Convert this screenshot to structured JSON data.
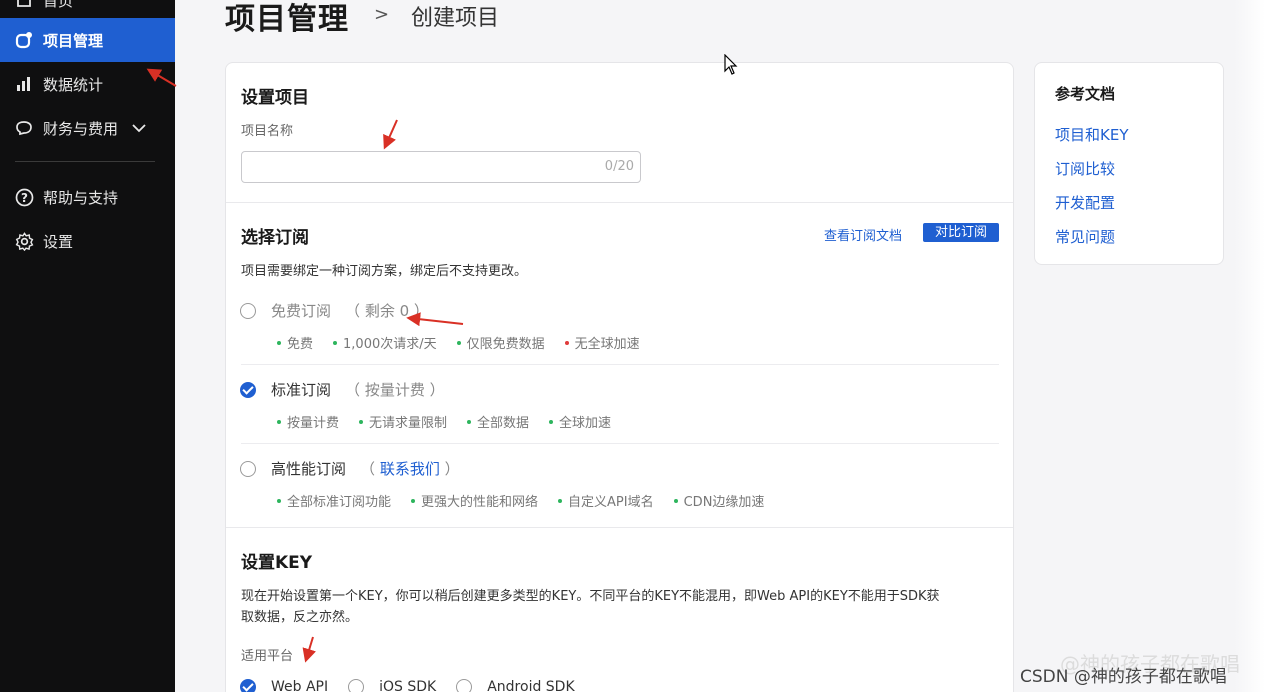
{
  "sidebar": {
    "items": [
      {
        "label": "首页",
        "icon": "home-icon"
      },
      {
        "label": "项目管理",
        "icon": "project-icon",
        "active": true
      },
      {
        "label": "数据统计",
        "icon": "bar-chart-icon"
      },
      {
        "label": "财务与费用",
        "icon": "wallet-icon",
        "expand": "chevron-down-icon"
      },
      {
        "label": "帮助与支持",
        "icon": "help-icon"
      },
      {
        "label": "设置",
        "icon": "gear-icon"
      }
    ]
  },
  "header": {
    "title": "项目管理",
    "separator": ">",
    "crumb": "创建项目"
  },
  "setup_project": {
    "title": "设置项目",
    "name_label": "项目名称",
    "name_value": "",
    "name_counter": "0/20"
  },
  "subscription": {
    "title": "选择订阅",
    "doc_link": "查看订阅文档",
    "compare_button": "对比订阅",
    "description": "项目需要绑定一种订阅方案，绑定后不支持更改。",
    "options": [
      {
        "name": "免费订阅",
        "note_open": "（",
        "note": "剩余 0",
        "note_close": "）",
        "checked": false,
        "disabled": true,
        "features": [
          {
            "text": "免费",
            "status": "ok"
          },
          {
            "text": "1,000次请求/天",
            "status": "ok"
          },
          {
            "text": "仅限免费数据",
            "status": "ok"
          },
          {
            "text": "无全球加速",
            "status": "no"
          }
        ]
      },
      {
        "name": "标准订阅",
        "note_open": "（",
        "note": "按量计费",
        "note_close": "）",
        "checked": true,
        "features": [
          {
            "text": "按量计费",
            "status": "ok"
          },
          {
            "text": "无请求量限制",
            "status": "ok"
          },
          {
            "text": "全部数据",
            "status": "ok"
          },
          {
            "text": "全球加速",
            "status": "ok"
          }
        ]
      },
      {
        "name": "高性能订阅",
        "note_open": "（",
        "note": "联系我们",
        "note_close": "）",
        "checked": false,
        "features": [
          {
            "text": "全部标准订阅功能",
            "status": "ok"
          },
          {
            "text": "更强大的性能和网络",
            "status": "ok"
          },
          {
            "text": "自定义API域名",
            "status": "ok"
          },
          {
            "text": "CDN边缘加速",
            "status": "ok"
          }
        ]
      }
    ]
  },
  "setup_key": {
    "title": "设置KEY",
    "description_line1": "现在开始设置第一个KEY，你可以稍后创建更多类型的KEY。不同平台的KEY不能混用，即Web API的KEY不能用于SDK获",
    "description_line2": "取数据，反之亦然。",
    "platform_label": "适用平台",
    "platforms": [
      {
        "label": "Web API",
        "checked": true
      },
      {
        "label": "iOS SDK",
        "checked": false
      },
      {
        "label": "Android SDK",
        "checked": false
      }
    ]
  },
  "references": {
    "title": "参考文档",
    "links": [
      "项目和KEY",
      "订阅比较",
      "开发配置",
      "常见问题"
    ]
  },
  "watermark": {
    "faint": "@神的孩子都在歌唱",
    "text": "CSDN @神的孩子都在歌唱"
  },
  "colors": {
    "accent": "#1f5fd1",
    "sidebar_bg": "#0f0f10",
    "ok_dot": "#2db55d",
    "no_dot": "#e03b3b",
    "annotation": "#d93025"
  }
}
